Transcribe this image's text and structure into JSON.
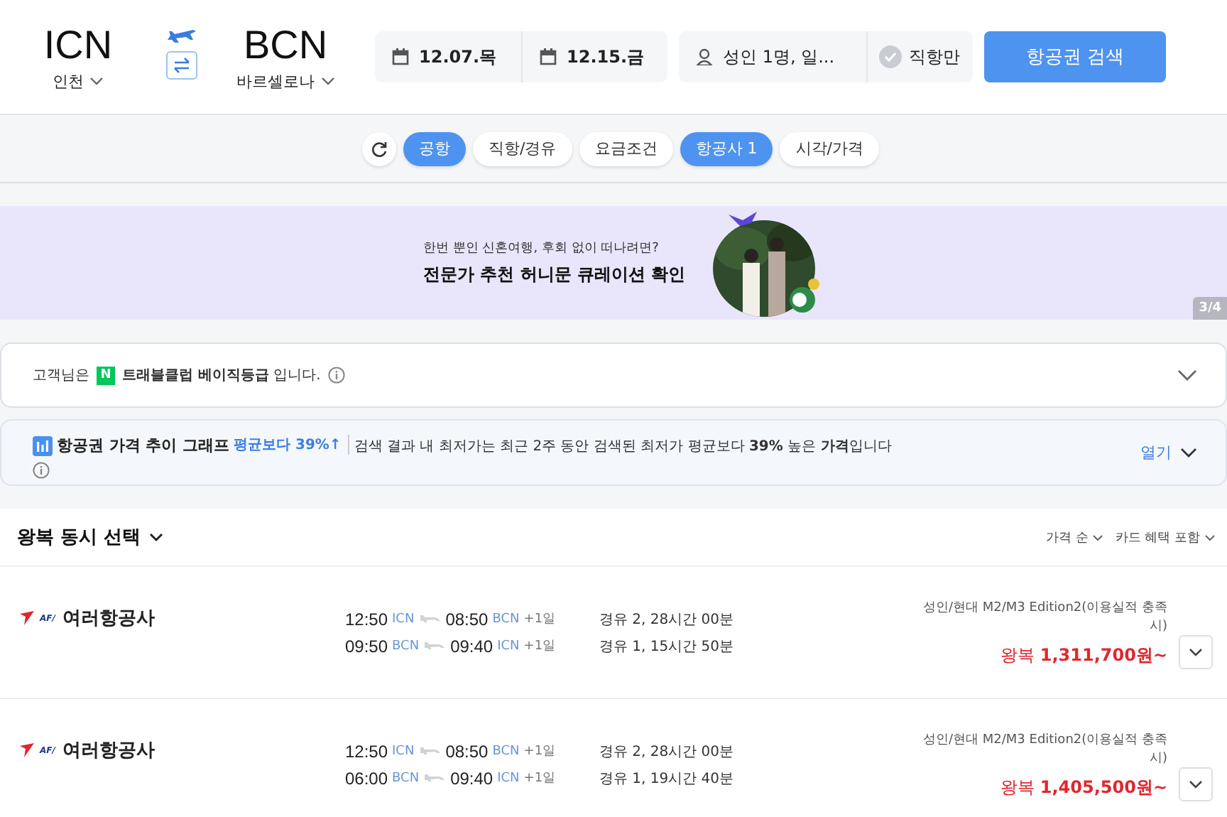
{
  "route": {
    "origin": {
      "code": "ICN",
      "city": "인천"
    },
    "destination": {
      "code": "BCN",
      "city": "바르셀로나"
    }
  },
  "dates": [
    "12.07.목",
    "12.15.금"
  ],
  "passengers": "성인 1명, 일...",
  "direct_only": {
    "label": "직항만",
    "checked": false
  },
  "search_button": "항공권 검색",
  "filters": [
    {
      "label": "공항",
      "selected": true
    },
    {
      "label": "직항/경유",
      "selected": false
    },
    {
      "label": "요금조건",
      "selected": false
    },
    {
      "label": "항공사 1",
      "selected": true
    },
    {
      "label": "시각/가격",
      "selected": false
    }
  ],
  "banner": {
    "subtitle": "한번 뿐인 신혼여행, 후회 없이 떠나려면?",
    "headline": "전문가 추천 **허니문 큐레이션** 확인",
    "page": "3/4"
  },
  "membership": {
    "prefix": "고객님은",
    "badge": "N",
    "text": "**트래블클럽 베이직등급** 입니다."
  },
  "price_trend": {
    "title": "항공권 가격 추이 그래프",
    "badge": "평균보다 39%↑",
    "text": "검색 결과 내 최저가는 최근 2주 동안 검색된 최저가 평균보다 **39%** 높은 **가격**입니다",
    "open": "열기"
  },
  "list_header": {
    "title": "왕복 동시 선택",
    "sort": [
      "가격 순",
      "카드 혜택 포함"
    ]
  },
  "results": [
    {
      "logo_text": "AF/",
      "airline": "여러항공사",
      "legs": [
        {
          "dep_time": "12:50",
          "dep": "ICN",
          "arr_time": "08:50",
          "arr": "BCN",
          "plus": "+1일",
          "info": "경유 2, 28시간 00분"
        },
        {
          "dep_time": "09:50",
          "dep": "BCN",
          "arr_time": "09:40",
          "arr": "ICN",
          "plus": "+1일",
          "info": "경유 1, 15시간 50분"
        }
      ],
      "fare_note": "성인/현대 M2/M3 Edition2(이용실적 충족시)",
      "price": "왕복 **1,311,700원~**"
    },
    {
      "logo_text": "AF/",
      "airline": "여러항공사",
      "legs": [
        {
          "dep_time": "12:50",
          "dep": "ICN",
          "arr_time": "08:50",
          "arr": "BCN",
          "plus": "+1일",
          "info": "경유 2, 28시간 00분"
        },
        {
          "dep_time": "06:00",
          "dep": "BCN",
          "arr_time": "09:40",
          "arr": "ICN",
          "plus": "+1일",
          "info": "경유 1, 19시간 40분"
        }
      ],
      "fare_note": "성인/현대 M2/M3 Edition2(이용실적 충족시)",
      "price": "왕복 **1,405,500원~**"
    }
  ]
}
